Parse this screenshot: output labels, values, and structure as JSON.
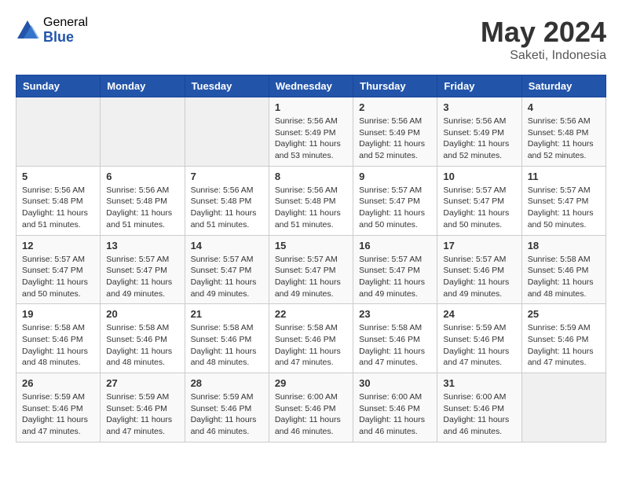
{
  "header": {
    "logo_general": "General",
    "logo_blue": "Blue",
    "month": "May 2024",
    "location": "Saketi, Indonesia"
  },
  "weekdays": [
    "Sunday",
    "Monday",
    "Tuesday",
    "Wednesday",
    "Thursday",
    "Friday",
    "Saturday"
  ],
  "weeks": [
    [
      {
        "day": "",
        "info": ""
      },
      {
        "day": "",
        "info": ""
      },
      {
        "day": "",
        "info": ""
      },
      {
        "day": "1",
        "info": "Sunrise: 5:56 AM\nSunset: 5:49 PM\nDaylight: 11 hours\nand 53 minutes."
      },
      {
        "day": "2",
        "info": "Sunrise: 5:56 AM\nSunset: 5:49 PM\nDaylight: 11 hours\nand 52 minutes."
      },
      {
        "day": "3",
        "info": "Sunrise: 5:56 AM\nSunset: 5:49 PM\nDaylight: 11 hours\nand 52 minutes."
      },
      {
        "day": "4",
        "info": "Sunrise: 5:56 AM\nSunset: 5:48 PM\nDaylight: 11 hours\nand 52 minutes."
      }
    ],
    [
      {
        "day": "5",
        "info": "Sunrise: 5:56 AM\nSunset: 5:48 PM\nDaylight: 11 hours\nand 51 minutes."
      },
      {
        "day": "6",
        "info": "Sunrise: 5:56 AM\nSunset: 5:48 PM\nDaylight: 11 hours\nand 51 minutes."
      },
      {
        "day": "7",
        "info": "Sunrise: 5:56 AM\nSunset: 5:48 PM\nDaylight: 11 hours\nand 51 minutes."
      },
      {
        "day": "8",
        "info": "Sunrise: 5:56 AM\nSunset: 5:48 PM\nDaylight: 11 hours\nand 51 minutes."
      },
      {
        "day": "9",
        "info": "Sunrise: 5:57 AM\nSunset: 5:47 PM\nDaylight: 11 hours\nand 50 minutes."
      },
      {
        "day": "10",
        "info": "Sunrise: 5:57 AM\nSunset: 5:47 PM\nDaylight: 11 hours\nand 50 minutes."
      },
      {
        "day": "11",
        "info": "Sunrise: 5:57 AM\nSunset: 5:47 PM\nDaylight: 11 hours\nand 50 minutes."
      }
    ],
    [
      {
        "day": "12",
        "info": "Sunrise: 5:57 AM\nSunset: 5:47 PM\nDaylight: 11 hours\nand 50 minutes."
      },
      {
        "day": "13",
        "info": "Sunrise: 5:57 AM\nSunset: 5:47 PM\nDaylight: 11 hours\nand 49 minutes."
      },
      {
        "day": "14",
        "info": "Sunrise: 5:57 AM\nSunset: 5:47 PM\nDaylight: 11 hours\nand 49 minutes."
      },
      {
        "day": "15",
        "info": "Sunrise: 5:57 AM\nSunset: 5:47 PM\nDaylight: 11 hours\nand 49 minutes."
      },
      {
        "day": "16",
        "info": "Sunrise: 5:57 AM\nSunset: 5:47 PM\nDaylight: 11 hours\nand 49 minutes."
      },
      {
        "day": "17",
        "info": "Sunrise: 5:57 AM\nSunset: 5:46 PM\nDaylight: 11 hours\nand 49 minutes."
      },
      {
        "day": "18",
        "info": "Sunrise: 5:58 AM\nSunset: 5:46 PM\nDaylight: 11 hours\nand 48 minutes."
      }
    ],
    [
      {
        "day": "19",
        "info": "Sunrise: 5:58 AM\nSunset: 5:46 PM\nDaylight: 11 hours\nand 48 minutes."
      },
      {
        "day": "20",
        "info": "Sunrise: 5:58 AM\nSunset: 5:46 PM\nDaylight: 11 hours\nand 48 minutes."
      },
      {
        "day": "21",
        "info": "Sunrise: 5:58 AM\nSunset: 5:46 PM\nDaylight: 11 hours\nand 48 minutes."
      },
      {
        "day": "22",
        "info": "Sunrise: 5:58 AM\nSunset: 5:46 PM\nDaylight: 11 hours\nand 47 minutes."
      },
      {
        "day": "23",
        "info": "Sunrise: 5:58 AM\nSunset: 5:46 PM\nDaylight: 11 hours\nand 47 minutes."
      },
      {
        "day": "24",
        "info": "Sunrise: 5:59 AM\nSunset: 5:46 PM\nDaylight: 11 hours\nand 47 minutes."
      },
      {
        "day": "25",
        "info": "Sunrise: 5:59 AM\nSunset: 5:46 PM\nDaylight: 11 hours\nand 47 minutes."
      }
    ],
    [
      {
        "day": "26",
        "info": "Sunrise: 5:59 AM\nSunset: 5:46 PM\nDaylight: 11 hours\nand 47 minutes."
      },
      {
        "day": "27",
        "info": "Sunrise: 5:59 AM\nSunset: 5:46 PM\nDaylight: 11 hours\nand 47 minutes."
      },
      {
        "day": "28",
        "info": "Sunrise: 5:59 AM\nSunset: 5:46 PM\nDaylight: 11 hours\nand 46 minutes."
      },
      {
        "day": "29",
        "info": "Sunrise: 6:00 AM\nSunset: 5:46 PM\nDaylight: 11 hours\nand 46 minutes."
      },
      {
        "day": "30",
        "info": "Sunrise: 6:00 AM\nSunset: 5:46 PM\nDaylight: 11 hours\nand 46 minutes."
      },
      {
        "day": "31",
        "info": "Sunrise: 6:00 AM\nSunset: 5:46 PM\nDaylight: 11 hours\nand 46 minutes."
      },
      {
        "day": "",
        "info": ""
      }
    ]
  ]
}
